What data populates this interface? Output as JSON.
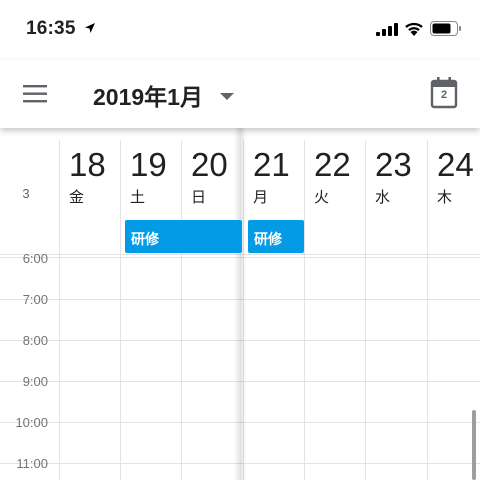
{
  "status_bar": {
    "time": "16:35"
  },
  "app_bar": {
    "month_title": "2019年1月",
    "today_number": "2"
  },
  "calendar": {
    "week_number": "3",
    "days": [
      {
        "number": "18",
        "weekday": "金"
      },
      {
        "number": "19",
        "weekday": "土"
      },
      {
        "number": "20",
        "weekday": "日"
      },
      {
        "number": "21",
        "weekday": "月"
      },
      {
        "number": "22",
        "weekday": "火"
      },
      {
        "number": "23",
        "weekday": "水"
      },
      {
        "number": "24",
        "weekday": "木"
      }
    ],
    "events": [
      {
        "title": "研修",
        "days": "19-20"
      },
      {
        "title": "研修",
        "days": "21"
      }
    ],
    "event_color": "#039be5",
    "times": [
      "6:00",
      "7:00",
      "8:00",
      "9:00",
      "10:00",
      "11:00"
    ]
  }
}
